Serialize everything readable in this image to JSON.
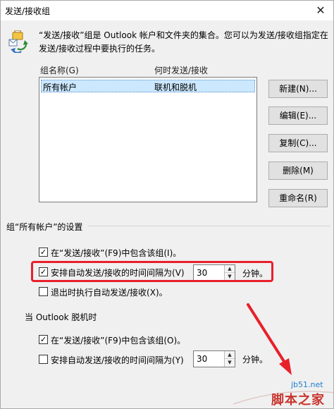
{
  "window": {
    "title": "发送/接收组",
    "close_glyph": "✕"
  },
  "intro_text": "“发送/接收”组是 Outlook 帐户和文件夹的集合。您可以为发送/接收组指定在发送/接收过程中要执行的任务。",
  "list": {
    "headers": {
      "name": "组名称(G)",
      "when": "何时发送/接收"
    },
    "rows": [
      {
        "name": "所有帐户",
        "when": "联机和脱机"
      }
    ]
  },
  "buttons": {
    "new": "新建(N)...",
    "edit": "编辑(E)...",
    "copy": "复制(C)...",
    "delete": "删除(M)",
    "rename": "重命名(R)"
  },
  "group_settings": {
    "heading": "组“所有帐户”的设置",
    "include_label": "在“发送/接收”(F9)中包含该组(I)。",
    "include_checked": true,
    "schedule_label": "安排自动发送/接收的时间间隔为(V)",
    "schedule_checked": true,
    "schedule_value": "30",
    "unit": "分钟。",
    "exit_label": "退出时执行自动发送/接收(X)。",
    "exit_checked": false
  },
  "offline_settings": {
    "heading": "当 Outlook 脱机时",
    "include_label": "在“发送/接收”(F9)中包含该组(O)。",
    "include_checked": true,
    "schedule_label": "安排自动发送/接收的时间间隔为(Y)",
    "schedule_checked": false,
    "schedule_value": "30",
    "unit": "分钟。"
  },
  "glyphs": {
    "check": "✓",
    "spin_up": "▲",
    "spin_down": "▼"
  },
  "watermark": {
    "url": "jb51.net",
    "text": "脚本之家"
  },
  "colors": {
    "highlight": "#e8202a",
    "selection": "#cce8ff"
  }
}
